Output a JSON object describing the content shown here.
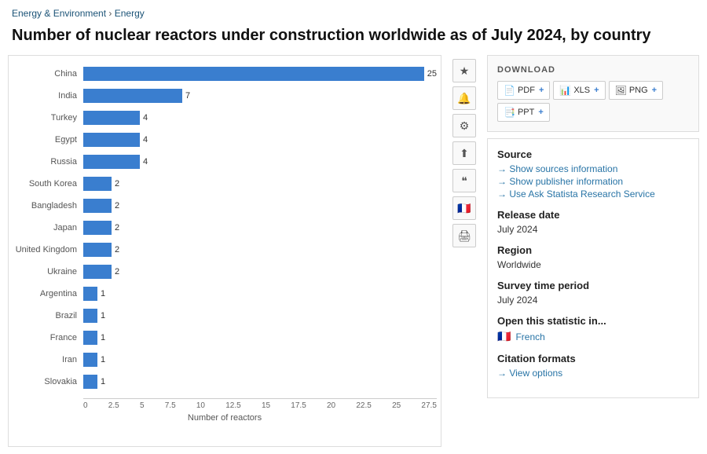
{
  "breadcrumb": {
    "part1": "Energy & Environment",
    "separator": " › ",
    "part2": "Energy"
  },
  "title": "Number of nuclear reactors under construction worldwide as of July 2024, by country",
  "chart": {
    "bars": [
      {
        "country": "China",
        "value": 25,
        "pct": 100
      },
      {
        "country": "India",
        "value": 7,
        "pct": 28
      },
      {
        "country": "Turkey",
        "value": 4,
        "pct": 16
      },
      {
        "country": "Egypt",
        "value": 4,
        "pct": 16
      },
      {
        "country": "Russia",
        "value": 4,
        "pct": 16
      },
      {
        "country": "South Korea",
        "value": 2,
        "pct": 8
      },
      {
        "country": "Bangladesh",
        "value": 2,
        "pct": 8
      },
      {
        "country": "Japan",
        "value": 2,
        "pct": 8
      },
      {
        "country": "United Kingdom",
        "value": 2,
        "pct": 8
      },
      {
        "country": "Ukraine",
        "value": 2,
        "pct": 8
      },
      {
        "country": "Argentina",
        "value": 1,
        "pct": 4
      },
      {
        "country": "Brazil",
        "value": 1,
        "pct": 4
      },
      {
        "country": "France",
        "value": 1,
        "pct": 4
      },
      {
        "country": "Iran",
        "value": 1,
        "pct": 4
      },
      {
        "country": "Slovakia",
        "value": 1,
        "pct": 4
      }
    ],
    "x_ticks": [
      "0",
      "2.5",
      "5",
      "7.5",
      "10",
      "12.5",
      "15",
      "17.5",
      "20",
      "22.5",
      "25",
      "27.5"
    ],
    "x_axis_label": "Number of reactors",
    "max_value": 25
  },
  "sidebar_icons": {
    "star": "★",
    "bell": "🔔",
    "gear": "⚙",
    "share": "⬆",
    "quote": "❝",
    "flag": "🇫🇷",
    "print": "🖨"
  },
  "download": {
    "title": "DOWNLOAD",
    "buttons": [
      {
        "label": "PDF",
        "icon": "pdf"
      },
      {
        "label": "XLS",
        "icon": "xls"
      },
      {
        "label": "PNG",
        "icon": "png"
      },
      {
        "label": "PPT",
        "icon": "ppt"
      }
    ]
  },
  "info": {
    "source_label": "Source",
    "source_links": [
      "Show sources information",
      "Show publisher information",
      "Use Ask Statista Research Service"
    ],
    "release_date_label": "Release date",
    "release_date_value": "July 2024",
    "region_label": "Region",
    "region_value": "Worldwide",
    "survey_period_label": "Survey time period",
    "survey_period_value": "July 2024",
    "open_in_label": "Open this statistic in...",
    "open_in_french": "French",
    "citation_label": "Citation formats",
    "citation_link": "View options"
  }
}
